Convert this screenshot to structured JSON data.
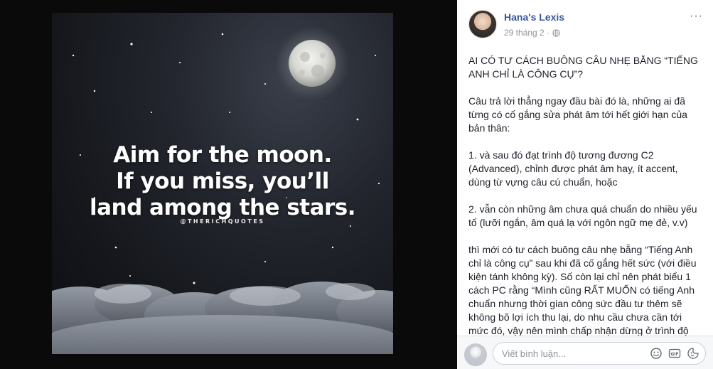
{
  "photo": {
    "quote_lines": [
      "Aim for the moon.",
      "If you miss, you’ll",
      "land among the stars."
    ],
    "handle": "@THERICHQUOTES"
  },
  "post": {
    "author": "Hana's Lexis",
    "date": "29 tháng 2 ·",
    "more_label": "···",
    "paragraphs": [
      "AI CÓ TƯ CÁCH BUÔNG CÂU NHẸ BẰNG “TIẾNG ANH CHỈ LÀ CÔNG CỤ”?",
      "Câu trả lời thẳng ngay đầu bài đó là, những ai đã từng có cố gắng sửa phát âm tới hết giới hạn của bản thân:",
      "1. và sau đó đạt trình độ tương đương C2 (Advanced), chỉnh được phát âm hay, ít accent, dùng từ vựng câu cú chuẩn, hoặc",
      "2. vẫn còn những âm chưa quá chuẩn do nhiều yếu tố (lưỡi ngắn, âm quá lạ với ngôn ngữ mẹ đẻ, v.v)",
      "thì mới có tư cách buông câu nhẹ bẵng “Tiếng Anh chỉ là công cụ” sau khi đã cố gắng hết sức (với điều kiện tánh không kỳ). Số còn lại chỉ nên phát biểu 1 cách PC rằng “Mình cũng RẤT MUỐN có tiếng Anh chuẩn nhưng thời gian công sức đầu tư thêm sẽ không bõ lợi ích thu lại, do nhu cầu chưa cần tới mức đó, vậy nên mình chấp nhận dừng ở trình độ hiện tại.” Câu này vốn dĩ đồng nghĩa với câu “Tiếng"
    ]
  },
  "comment": {
    "placeholder": "Viết bình luận...",
    "icons": [
      "emoji-icon",
      "gif-icon",
      "sticker-icon"
    ]
  },
  "colors": {
    "link": "#385898",
    "text": "#1d2129",
    "muted": "#90949c"
  }
}
